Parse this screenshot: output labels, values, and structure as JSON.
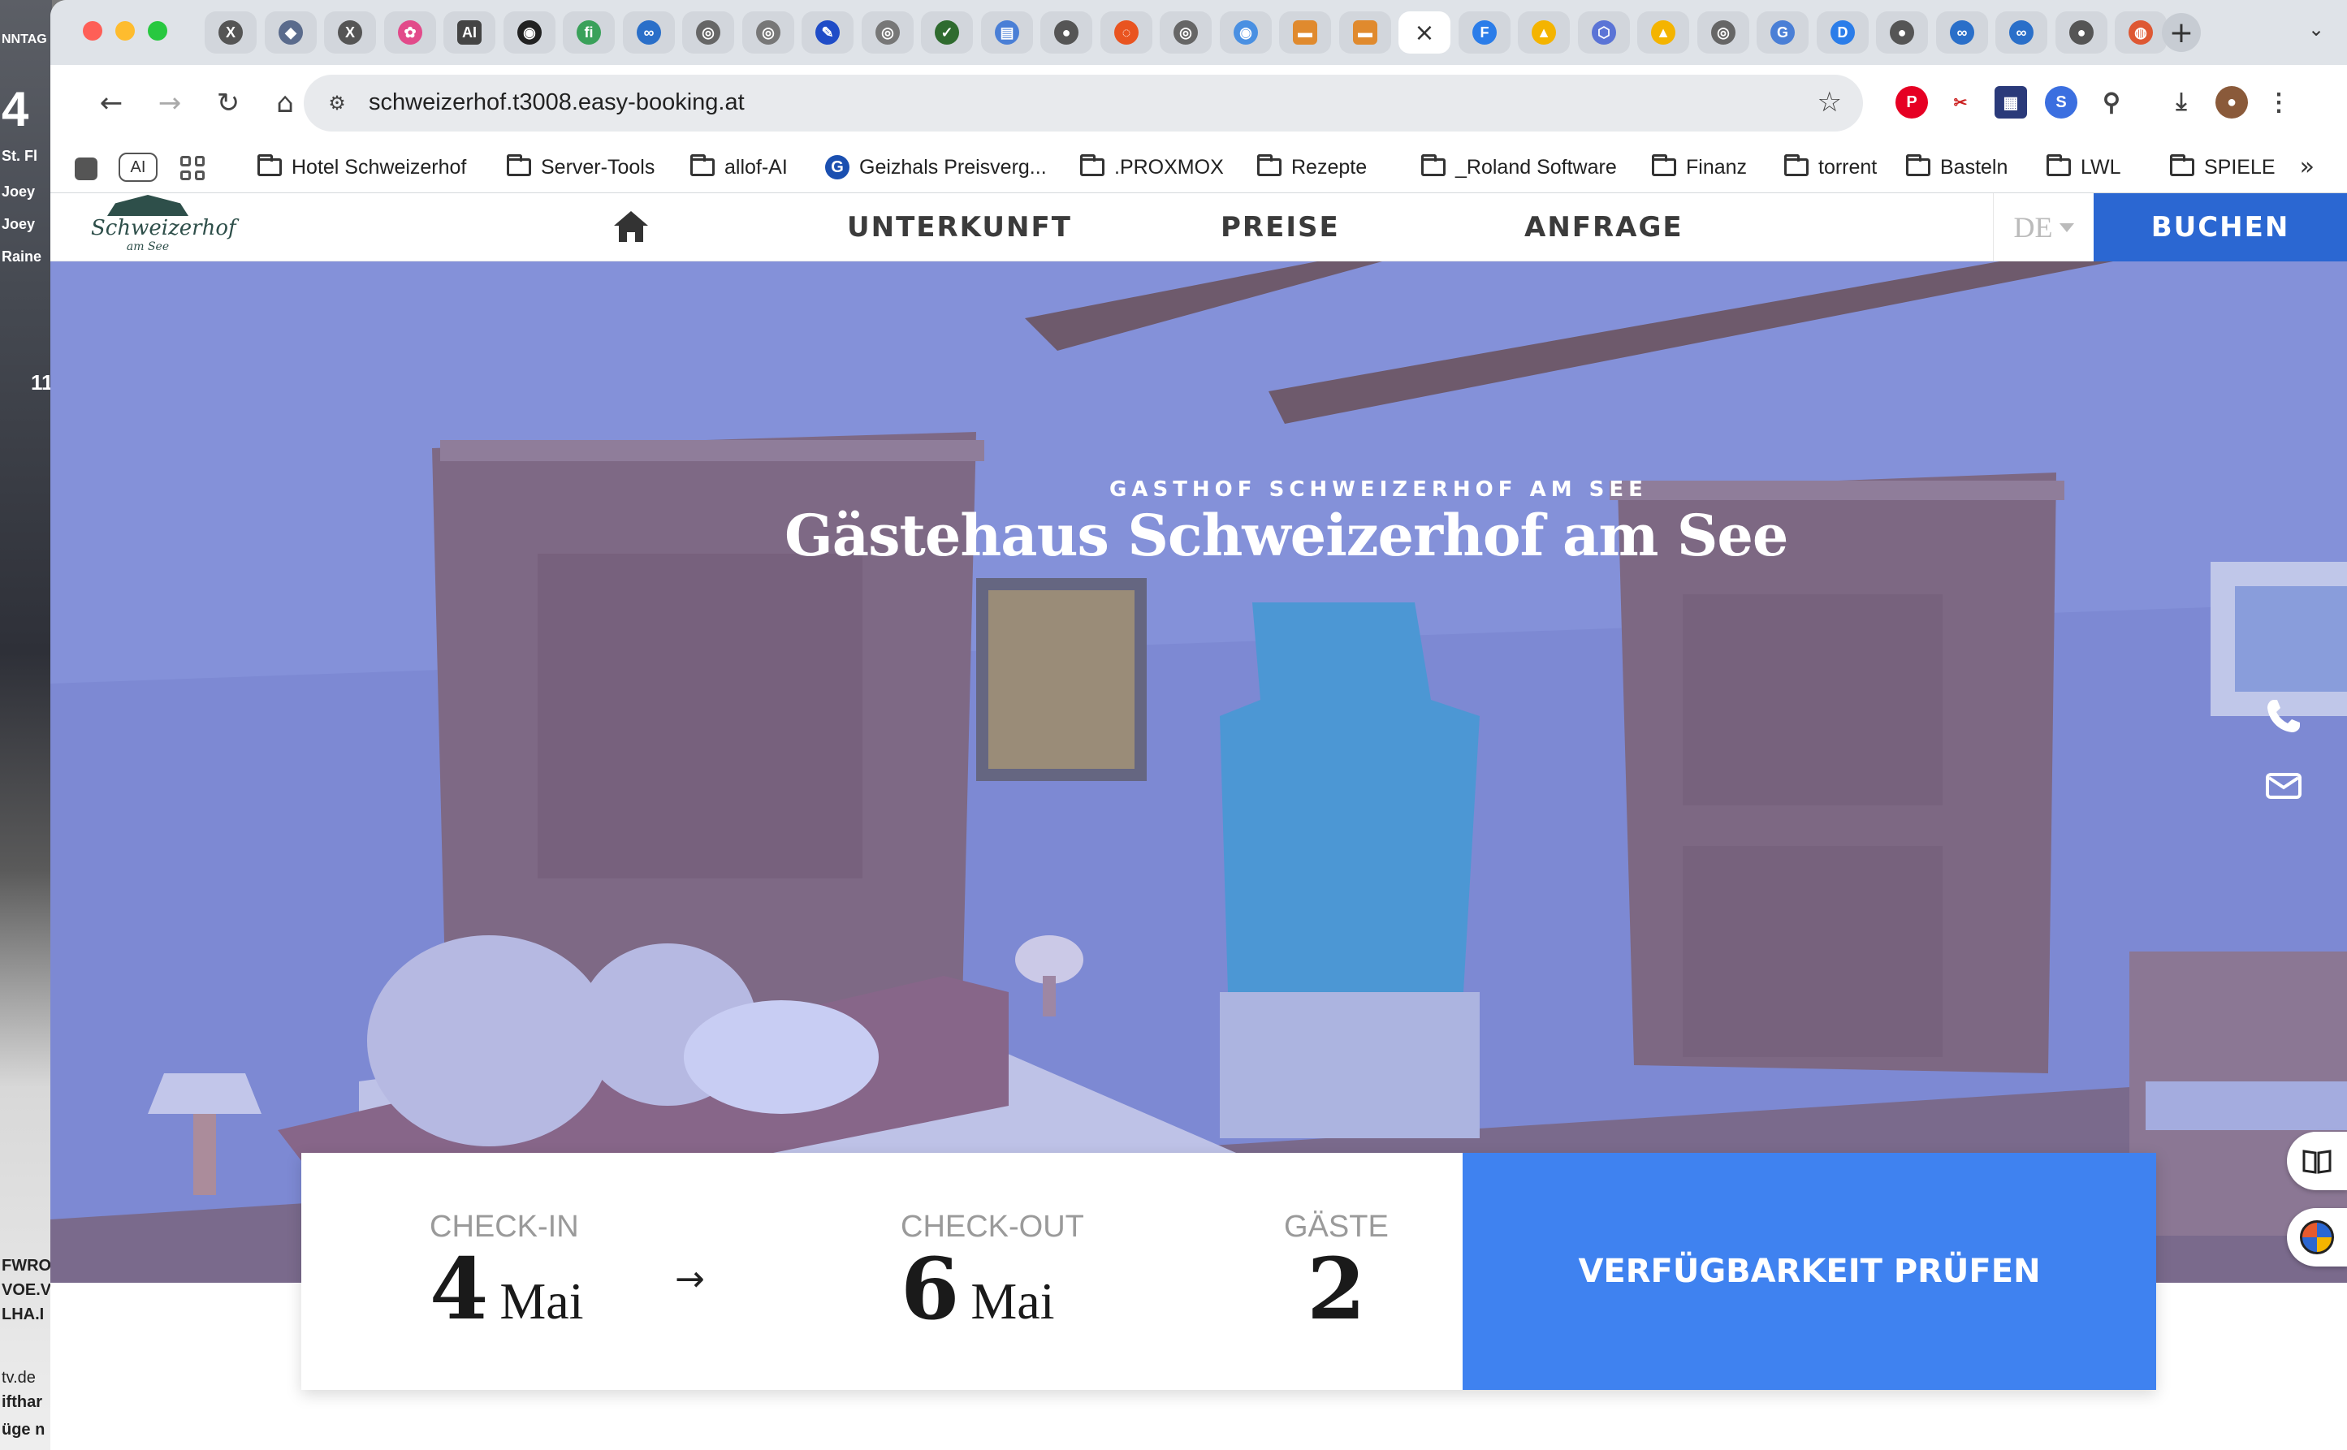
{
  "desktop": {
    "strip_texts": [
      "NNTAG",
      "4",
      "St. Fl",
      "Joey",
      "Joey",
      "Raine",
      "11",
      "FWRO",
      "VOE.V",
      "LHA.I",
      "tv.de",
      "ifthar",
      "üge n"
    ]
  },
  "browser": {
    "tabs": [
      {
        "icon": "x-logo-icon",
        "color": "#555555",
        "glyph": "X"
      },
      {
        "icon": "tool-icon",
        "color": "#5a6b8c",
        "glyph": "◆"
      },
      {
        "icon": "x-logo-icon",
        "color": "#555555",
        "glyph": "X"
      },
      {
        "icon": "colorful-icon",
        "color": "#e24a8a",
        "glyph": "✿"
      },
      {
        "icon": "ai-icon",
        "color": "#444444",
        "glyph": "AI"
      },
      {
        "icon": "github-icon",
        "color": "#222222",
        "glyph": "◉"
      },
      {
        "icon": "fi-icon",
        "color": "#3aa15a",
        "glyph": "fi"
      },
      {
        "icon": "nextcloud-icon",
        "color": "#2a6fc9",
        "glyph": "∞"
      },
      {
        "icon": "globe-icon",
        "color": "#666666",
        "glyph": "◎"
      },
      {
        "icon": "globe-icon",
        "color": "#777777",
        "glyph": "◎"
      },
      {
        "icon": "pen-icon",
        "color": "#1f4cc7",
        "glyph": "✎"
      },
      {
        "icon": "globe-icon",
        "color": "#777777",
        "glyph": "◎"
      },
      {
        "icon": "leaf-icon",
        "color": "#2f6b2f",
        "glyph": "✓"
      },
      {
        "icon": "doc-icon",
        "color": "#4a7fd6",
        "glyph": "▤"
      },
      {
        "icon": "globe-icon",
        "color": "#555555",
        "glyph": "●"
      },
      {
        "icon": "ubuntu-icon",
        "color": "#e95420",
        "glyph": "◌"
      },
      {
        "icon": "globe-icon",
        "color": "#666666",
        "glyph": "◎"
      },
      {
        "icon": "chrome-icon",
        "color": "#4a90e2",
        "glyph": "◉"
      },
      {
        "icon": "orange-square-icon",
        "color": "#e08a2e",
        "glyph": "▬"
      },
      {
        "icon": "orange-square-icon",
        "color": "#e08a2e",
        "glyph": "▬"
      },
      {
        "icon": "close-tab-icon",
        "color": "#ffffff",
        "glyph": "×",
        "active": true
      },
      {
        "icon": "f-icon",
        "color": "#2b7de9",
        "glyph": "F"
      },
      {
        "icon": "drive-icon",
        "color": "#f4b400",
        "glyph": "▲"
      },
      {
        "icon": "hex-icon",
        "color": "#5b74d6",
        "glyph": "⬡"
      },
      {
        "icon": "drive-icon",
        "color": "#f4b400",
        "glyph": "▲"
      },
      {
        "icon": "globe-icon",
        "color": "#666666",
        "glyph": "◎"
      },
      {
        "icon": "translate-icon",
        "color": "#4a7fd6",
        "glyph": "G"
      },
      {
        "icon": "d-icon",
        "color": "#2b7de9",
        "glyph": "D"
      },
      {
        "icon": "globe-icon",
        "color": "#555555",
        "glyph": "●"
      },
      {
        "icon": "nextcloud-icon",
        "color": "#2a6fc9",
        "glyph": "∞"
      },
      {
        "icon": "nextcloud-icon",
        "color": "#2a6fc9",
        "glyph": "∞"
      },
      {
        "icon": "globe-icon",
        "color": "#555555",
        "glyph": "●"
      },
      {
        "icon": "duckduckgo-icon",
        "color": "#de5833",
        "glyph": "◍"
      }
    ],
    "new_tab_glyph": "+",
    "tab_menu_glyph": "⌄",
    "url": "schweizerhof.t3008.easy-booking.at",
    "bookmarks_left": {
      "ai_label": "AI"
    },
    "bookmarks": [
      {
        "label": "Hotel Schweizerhof",
        "type": "folder"
      },
      {
        "label": "Server-Tools",
        "type": "folder"
      },
      {
        "label": "allof-AI",
        "type": "folder"
      },
      {
        "label": "Geizhals Preisverg...",
        "type": "site"
      },
      {
        "label": ".PROXMOX",
        "type": "folder"
      },
      {
        "label": "Rezepte",
        "type": "folder"
      },
      {
        "label": "_Roland Software",
        "type": "folder"
      },
      {
        "label": "Finanz",
        "type": "folder"
      },
      {
        "label": "torrent",
        "type": "folder"
      },
      {
        "label": "Basteln",
        "type": "folder"
      },
      {
        "label": "LWL",
        "type": "folder"
      },
      {
        "label": "SPIELE",
        "type": "folder"
      }
    ],
    "bookmarks_more": "»",
    "geizhals_glyph": "G"
  },
  "site": {
    "logo": {
      "name": "Schweizerhof",
      "sub": "am See"
    },
    "nav": {
      "unterkunft": "UNTERKUNFT",
      "preise": "PREISE",
      "anfrage": "ANFRAGE"
    },
    "lang": "DE",
    "book_label": "BUCHEN",
    "hero": {
      "kicker": "GASTHOF SCHWEIZERHOF AM SEE",
      "title": "Gästehaus Schweizerhof am See"
    },
    "booking": {
      "checkin_label": "CHECK-IN",
      "checkin_day": "4",
      "checkin_month": "Mai",
      "checkout_label": "CHECK-OUT",
      "checkout_day": "6",
      "checkout_month": "Mai",
      "guests_label": "GÄSTE",
      "guests_value": "2",
      "arrow": "→",
      "submit_label": "VERFÜGBARKEIT PRÜFEN"
    },
    "colors": {
      "primary": "#2b67d2",
      "submit": "#3f82f0"
    }
  }
}
